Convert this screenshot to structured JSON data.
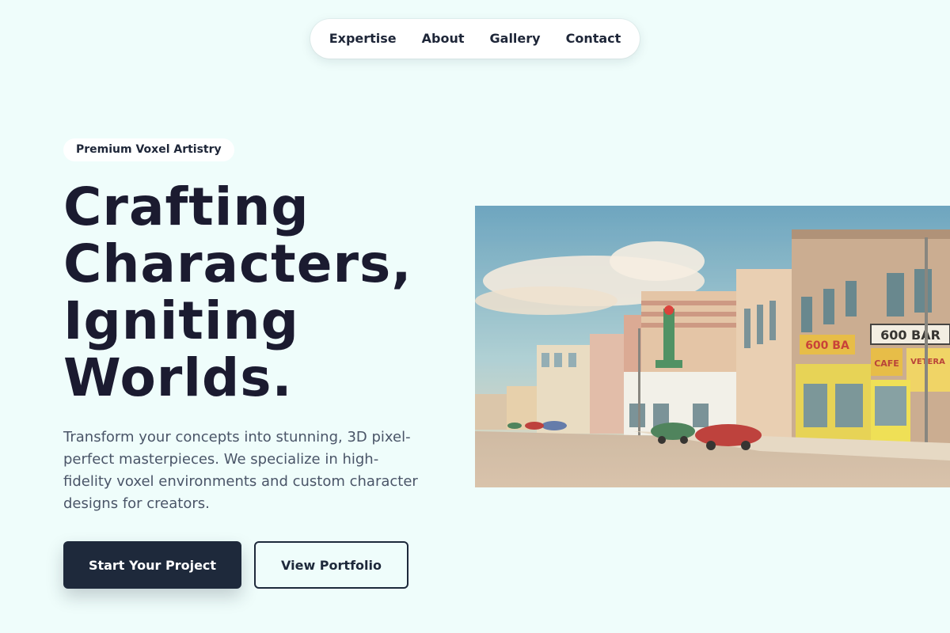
{
  "nav": {
    "items": [
      "Expertise",
      "About",
      "Gallery",
      "Contact"
    ]
  },
  "hero": {
    "badge": "Premium Voxel Artistry",
    "headline": [
      "Crafting",
      "Characters,",
      "Igniting",
      "Worlds."
    ],
    "description": "Transform your concepts into stunning, 3D pixel-perfect masterpieces. We specialize in high-fidelity voxel environments and custom character designs for creators.",
    "primary_button": "Start Your Project",
    "secondary_button": "View Portfolio"
  },
  "image": {
    "signs": [
      "600 BA",
      "600 BA",
      "CAFE",
      "600 BAR",
      "VETERA"
    ]
  },
  "colors": {
    "background": "#effdfb",
    "text_dark": "#1b1b30",
    "button_dark": "#1e293b",
    "body_text": "#4a5568"
  }
}
